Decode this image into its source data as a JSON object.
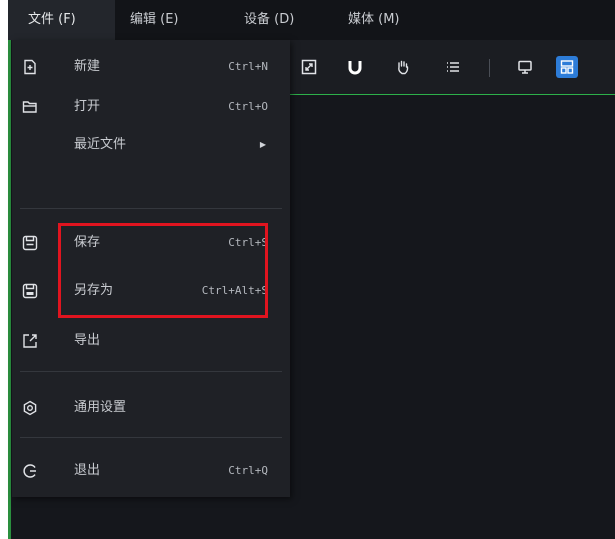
{
  "menubar": {
    "tabs": [
      {
        "label": "文件 (F)"
      },
      {
        "label": "编辑 (E)"
      },
      {
        "label": "设备 (D)"
      },
      {
        "label": "媒体 (M)"
      }
    ]
  },
  "file_menu": {
    "items": [
      {
        "label": "新建",
        "shortcut": "Ctrl+N",
        "icon": "new-file-icon"
      },
      {
        "label": "打开",
        "shortcut": "Ctrl+O",
        "icon": "folder-open-icon"
      },
      {
        "label": "最近文件",
        "icon": "submenu-arrow-icon"
      },
      {
        "label": "保存",
        "shortcut": "Ctrl+S",
        "icon": "save-icon"
      },
      {
        "label": "另存为",
        "shortcut": "Ctrl+Alt+S",
        "icon": "save-as-icon"
      },
      {
        "label": "导出",
        "icon": "export-icon"
      },
      {
        "label": "通用设置",
        "icon": "settings-icon"
      },
      {
        "label": "退出",
        "shortcut": "Ctrl+Q",
        "icon": "exit-icon"
      }
    ]
  },
  "toolbar": {
    "icons": [
      "fit-view-icon",
      "magnet-icon",
      "hand-icon",
      "list-icon",
      "monitor-icon",
      "layout-icon"
    ]
  },
  "colors": {
    "highlight": "#e0141f",
    "accent": "#2d7cd8",
    "toolbar_border": "#2db04a"
  }
}
